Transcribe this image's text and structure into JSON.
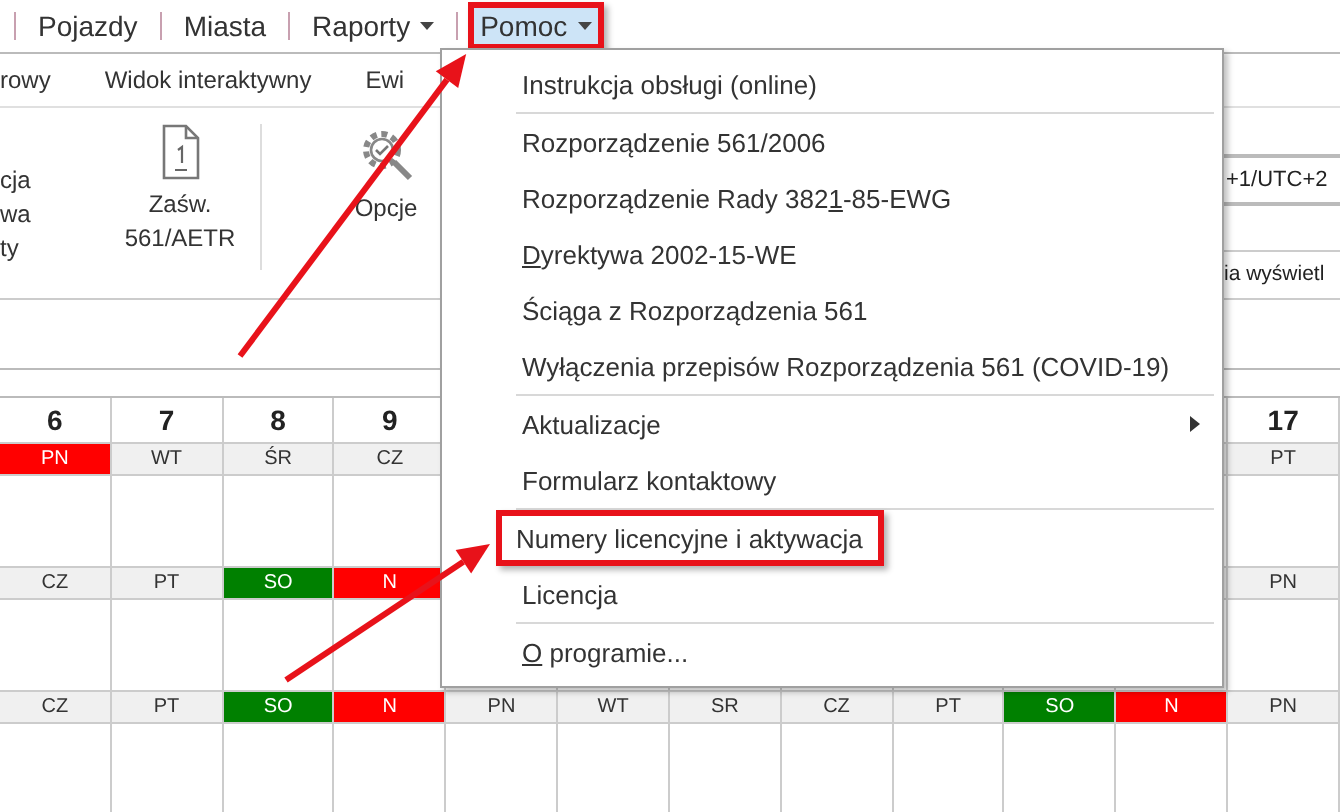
{
  "menu_bar": [
    {
      "label": "Pojazdy",
      "dropdown": false,
      "selected": false,
      "annotated": false
    },
    {
      "label": "Miasta",
      "dropdown": false,
      "selected": false,
      "annotated": false
    },
    {
      "label": "Raporty",
      "dropdown": true,
      "selected": false,
      "annotated": false
    },
    {
      "label": "Pomoc",
      "dropdown": true,
      "selected": true,
      "annotated": true
    }
  ],
  "ribbon_tabs": [
    {
      "label": "rowy"
    },
    {
      "label": "Widok interaktywny"
    },
    {
      "label": "Ewi"
    }
  ],
  "ribbon": {
    "buttons": [
      {
        "kind": "cut",
        "label_lines": [
          "cja",
          "wa",
          "ty"
        ]
      },
      {
        "kind": "document",
        "label_lines": [
          "Zaśw.",
          "561/AETR"
        ]
      },
      {
        "kind": "gear",
        "label_lines": [
          "Opcje"
        ]
      }
    ],
    "field_value": "+1/UTC+2",
    "option_text": "ia wyświetl"
  },
  "dropdown_menu": {
    "groups": [
      [
        {
          "segments": [
            {
              "text": "Instrukcja obsługi (online)"
            }
          ],
          "submenu": false,
          "annotated": false
        }
      ],
      [
        {
          "segments": [
            {
              "text": "Rozporządzenie 561/2006"
            }
          ],
          "submenu": false,
          "annotated": false
        },
        {
          "segments": [
            {
              "text": "Rozporządzenie Rady 382"
            },
            {
              "text": "1",
              "underlined": true
            },
            {
              "text": "-85-EWG"
            }
          ],
          "submenu": false,
          "annotated": false
        },
        {
          "segments": [
            {
              "text": "D",
              "underlined": true
            },
            {
              "text": "yrektywa 2002-15-WE"
            }
          ],
          "submenu": false,
          "annotated": false
        },
        {
          "segments": [
            {
              "text": "Ściąga z Rozporządzenia 561"
            }
          ],
          "submenu": false,
          "annotated": false
        },
        {
          "segments": [
            {
              "text": "Wyłączenia przepisów Rozporządzenia 561 (COVID-19)"
            }
          ],
          "submenu": false,
          "annotated": false
        }
      ],
      [
        {
          "segments": [
            {
              "text": "Aktualizacje"
            }
          ],
          "submenu": true,
          "annotated": false
        },
        {
          "segments": [
            {
              "text": "Formularz kontaktowy"
            }
          ],
          "submenu": false,
          "annotated": false
        }
      ],
      [
        {
          "segments": [
            {
              "text": "Numery licencyjne i aktywacja"
            }
          ],
          "submenu": false,
          "annotated": true
        },
        {
          "segments": [
            {
              "text": "Licencja"
            }
          ],
          "submenu": false,
          "annotated": false
        }
      ],
      [
        {
          "segments": [
            {
              "text": "O",
              "underlined": true
            },
            {
              "text": " programie..."
            }
          ],
          "submenu": false,
          "annotated": false
        }
      ]
    ]
  },
  "calendar": {
    "left_columns": [
      "6",
      "7",
      "8",
      "9"
    ],
    "right_columns": [
      "17"
    ],
    "weeks": [
      {
        "left": [
          {
            "label": "PN",
            "kind": "holiday"
          },
          {
            "label": "WT",
            "kind": "workday"
          },
          {
            "label": "ŚR",
            "kind": "workday"
          },
          {
            "label": "CZ",
            "kind": "workday"
          }
        ],
        "right": [
          {
            "label": "PT",
            "kind": "workday"
          }
        ]
      },
      {
        "left": [
          {
            "label": "CZ",
            "kind": "workday"
          },
          {
            "label": "PT",
            "kind": "workday"
          },
          {
            "label": "SO",
            "kind": "saturday"
          },
          {
            "label": "N",
            "kind": "holiday"
          }
        ],
        "right": [
          {
            "label": "PN",
            "kind": "workday"
          }
        ]
      },
      {
        "left": [
          {
            "label": "CZ",
            "kind": "workday"
          },
          {
            "label": "PT",
            "kind": "workday"
          },
          {
            "label": "SO",
            "kind": "saturday"
          },
          {
            "label": "N",
            "kind": "holiday"
          }
        ],
        "middle": [
          {
            "label": "PN",
            "kind": "workday"
          },
          {
            "label": "WT",
            "kind": "workday"
          },
          {
            "label": "SR",
            "kind": "workday"
          },
          {
            "label": "CZ",
            "kind": "workday"
          },
          {
            "label": "PT",
            "kind": "workday"
          },
          {
            "label": "SO",
            "kind": "saturday"
          },
          {
            "label": "N",
            "kind": "holiday"
          }
        ],
        "right": [
          {
            "label": "PN",
            "kind": "workday"
          }
        ]
      }
    ]
  }
}
